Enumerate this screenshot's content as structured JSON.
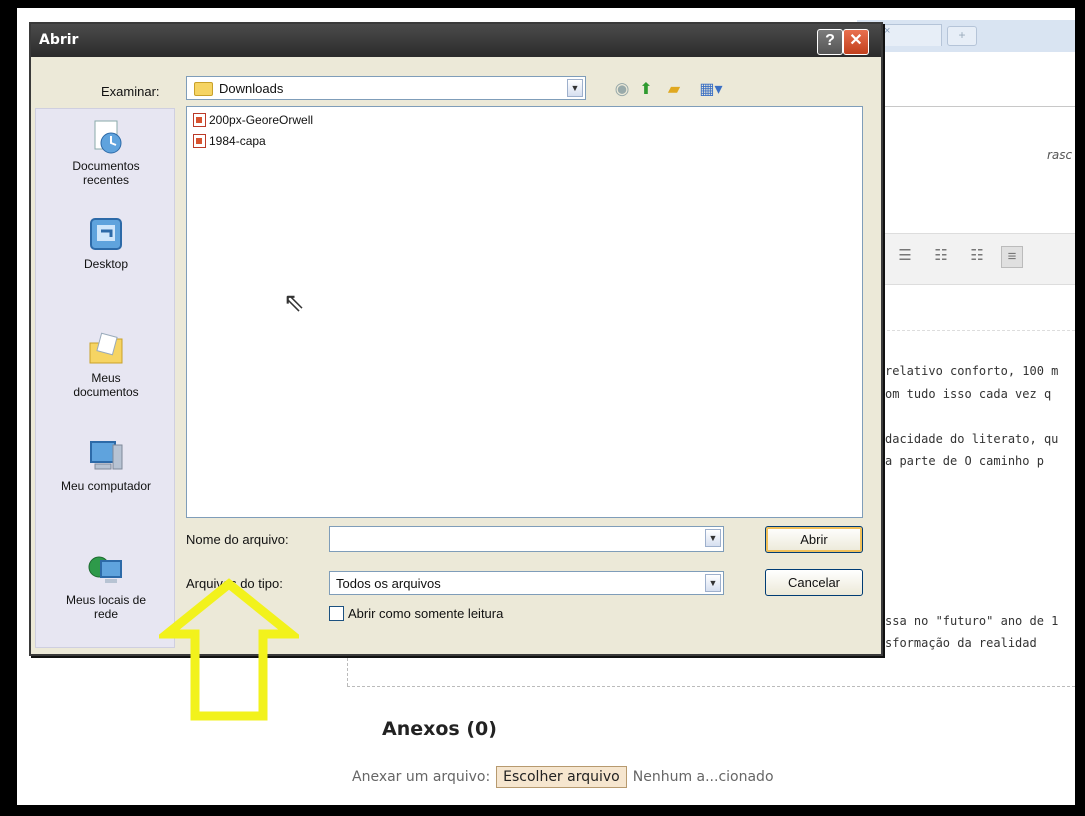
{
  "dialog": {
    "title": "Abrir",
    "help_button": "?",
    "close_button": "✕",
    "look_in_label": "Examinar:",
    "look_in_value": "Downloads",
    "places": [
      {
        "label_line1": "Documentos",
        "label_line2": "recentes",
        "icon": "recent-documents-icon"
      },
      {
        "label_line1": "Desktop",
        "label_line2": "",
        "icon": "desktop-icon"
      },
      {
        "label_line1": "Meus",
        "label_line2": "documentos",
        "icon": "my-documents-icon"
      },
      {
        "label_line1": "Meu computador",
        "label_line2": "",
        "icon": "my-computer-icon"
      },
      {
        "label_line1": "Meus locais de",
        "label_line2": "rede",
        "icon": "network-places-icon"
      }
    ],
    "files": [
      {
        "name": "200px-GeoreOrwell"
      },
      {
        "name": "1984-capa"
      }
    ],
    "filename_label": "Nome do arquivo:",
    "filename_value": "",
    "filetype_label": "Arquivos do tipo:",
    "filetype_value": "Todos os arquivos",
    "readonly_label": "Abrir como somente leitura",
    "open_button": "Abrir",
    "cancel_button": "Cancelar"
  },
  "background": {
    "italic_text": "rasc",
    "body_lines": [
      "relativo conforto, 100 m",
      "om tudo isso cada vez q",
      "dacidade do literato, qu",
      "a parte de O caminho p",
      "ssa no \"futuro\" ano de 1",
      "sformação da realidad"
    ],
    "attachments_title": "Anexos (0)",
    "attach_label": "Anexar um arquivo:",
    "choose_file_button": "Escolher arquivo",
    "no_file_text": "Nenhum a...cionado"
  },
  "colors": {
    "annotation_arrow": "#f2f21c",
    "titlebar": "#3a3a3a",
    "close_button": "#d4532f"
  }
}
